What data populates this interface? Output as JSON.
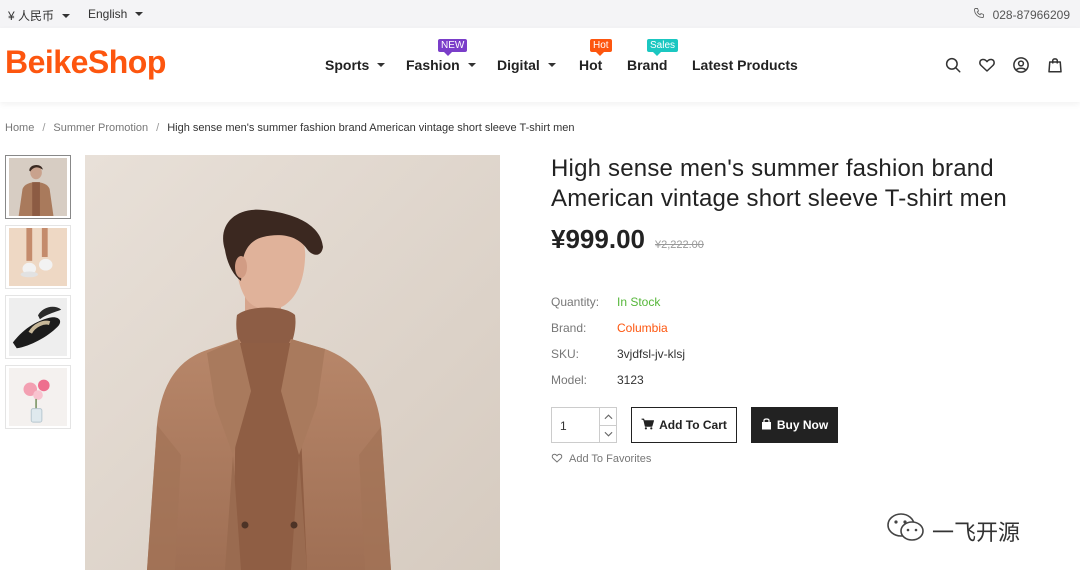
{
  "topbar": {
    "currency": "¥ 人民币",
    "language": "English",
    "phone": "028-87966209"
  },
  "header": {
    "logo": "BeikeShop",
    "nav": [
      {
        "label": "Sports"
      },
      {
        "label": "Fashion"
      },
      {
        "label": "Digital"
      },
      {
        "label": "Hot"
      },
      {
        "label": "Brand"
      },
      {
        "label": "Latest Products"
      }
    ],
    "badges": {
      "fashion": "NEW",
      "hot": "Hot",
      "brand": "Sales"
    }
  },
  "breadcrumb": {
    "home": "Home",
    "category": "Summer Promotion",
    "current": "High sense men's summer fashion brand American vintage short sleeve T-shirt men"
  },
  "product": {
    "title_line1": "High sense men's summer fashion brand",
    "title_line2": "American vintage short sleeve T-shirt men",
    "price": "¥999.00",
    "old_price": "¥2,222.00",
    "attributes": {
      "quantity_label": "Quantity:",
      "quantity_value": "In Stock",
      "brand_label": "Brand:",
      "brand_value": "Columbia",
      "sku_label": "SKU:",
      "sku_value": "3vjdfsl-jv-klsj",
      "model_label": "Model:",
      "model_value": "3123"
    },
    "quantity": "1",
    "add_to_cart": "Add To Cart",
    "buy_now": "Buy Now",
    "favorite": "Add To Favorites"
  },
  "watermark": "一飞开源",
  "colors": {
    "brand": "#fd560f",
    "in_stock": "#56b73a",
    "badge_new": "#7a3ec9",
    "badge_sales": "#1bc7c1",
    "dark": "#222222"
  },
  "icons": [
    "phone-icon",
    "search-icon",
    "heart-icon",
    "user-icon",
    "bag-icon",
    "cart-icon",
    "shopping-bag-icon",
    "wechat-icon"
  ]
}
